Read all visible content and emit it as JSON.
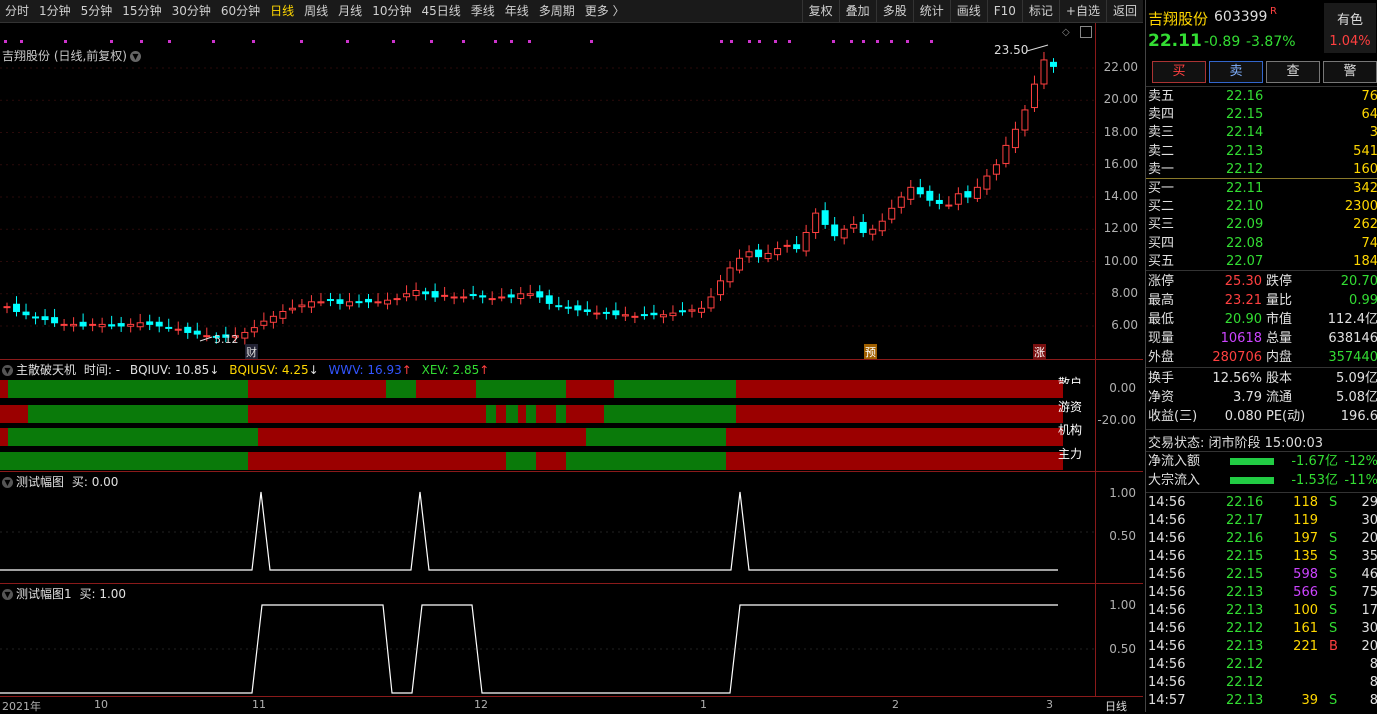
{
  "toolbar": {
    "timeframes": [
      "分时",
      "1分钟",
      "5分钟",
      "15分钟",
      "30分钟",
      "60分钟",
      "日线",
      "周线",
      "月线",
      "10分钟",
      "45日线",
      "季线",
      "年线",
      "多周期",
      "更多 〉"
    ],
    "active_timeframe": "日线",
    "buttons": [
      "复权",
      "叠加",
      "多股",
      "统计",
      "画线",
      "F10",
      "标记",
      "+自选",
      "返回"
    ]
  },
  "chart": {
    "title": "吉翔股份 (日线,前复权)",
    "high_label": "23.50",
    "low_label": "5.12",
    "markers": [
      "财",
      "预",
      "涨"
    ],
    "y_ticks": [
      "22.00",
      "20.00",
      "18.00",
      "16.00",
      "14.00",
      "12.00",
      "10.00",
      "8.00",
      "6.00"
    ],
    "x_labels": [
      "2021年",
      "10",
      "11",
      "12",
      "1",
      "2",
      "3"
    ],
    "period_label": "日线"
  },
  "indicator1": {
    "name": "主散破天机",
    "time_label": "时间: -",
    "bqiuv": "BQIUV: 10.85",
    "bqiusv": "BQIUSV: 4.25",
    "wwv": "WWV: 16.93",
    "xev": "XEV: 2.85",
    "row_labels": [
      "散户",
      "游资",
      "机构",
      "主力"
    ],
    "y_ticks": [
      "0.00",
      "-20.00"
    ]
  },
  "indicator2": {
    "name": "测试幅图",
    "buy": "买: 0.00",
    "y_ticks": [
      "1.00",
      "0.50"
    ]
  },
  "indicator3": {
    "name": "测试幅图1",
    "buy": "买: 1.00",
    "y_ticks": [
      "1.00",
      "0.50"
    ]
  },
  "quote": {
    "name": "吉翔股份",
    "code": "603399",
    "flag": "R",
    "badge": "有色",
    "badge_pct": "1.04%",
    "price": "22.11",
    "change": "-0.89",
    "change_pct": "-3.87%",
    "actions": [
      "买",
      "卖",
      "查",
      "警"
    ],
    "asks": [
      {
        "label": "卖五",
        "price": "22.16",
        "vol": "76"
      },
      {
        "label": "卖四",
        "price": "22.15",
        "vol": "64"
      },
      {
        "label": "卖三",
        "price": "22.14",
        "vol": "3"
      },
      {
        "label": "卖二",
        "price": "22.13",
        "vol": "541"
      },
      {
        "label": "卖一",
        "price": "22.12",
        "vol": "160"
      }
    ],
    "bids": [
      {
        "label": "买一",
        "price": "22.11",
        "vol": "342"
      },
      {
        "label": "买二",
        "price": "22.10",
        "vol": "2300"
      },
      {
        "label": "买三",
        "price": "22.09",
        "vol": "262"
      },
      {
        "label": "买四",
        "price": "22.08",
        "vol": "74"
      },
      {
        "label": "买五",
        "price": "22.07",
        "vol": "184"
      }
    ],
    "stats": [
      {
        "l1": "涨停",
        "v1": "25.30",
        "l2": "跌停",
        "v2": "20.70"
      },
      {
        "l1": "最高",
        "v1": "23.21",
        "l2": "量比",
        "v2": "0.99"
      },
      {
        "l1": "最低",
        "v1": "20.90",
        "l2": "市值",
        "v2": "112.4亿"
      },
      {
        "l1": "现量",
        "v1": "10618",
        "l2": "总量",
        "v2": "638146"
      },
      {
        "l1": "外盘",
        "v1": "280706",
        "l2": "内盘",
        "v2": "357440"
      }
    ],
    "stats2": [
      {
        "l1": "换手",
        "v1": "12.56%",
        "l2": "股本",
        "v2": "5.09亿"
      },
      {
        "l1": "净资",
        "v1": "3.79",
        "l2": "流通",
        "v2": "5.08亿"
      },
      {
        "l1": "收益(三)",
        "v1": "0.080",
        "l2": "PE(动)",
        "v2": "196.6"
      }
    ],
    "trade_status": "交易状态: 闭市阶段 15:00:03",
    "flows": [
      {
        "label": "净流入额",
        "value": "-1.67亿",
        "pct": "-12%"
      },
      {
        "label": "大宗流入",
        "value": "-1.53亿",
        "pct": "-11%"
      }
    ],
    "ticks": [
      {
        "t": "14:56",
        "p": "22.16",
        "v": "118",
        "s": "S",
        "n": "29"
      },
      {
        "t": "14:56",
        "p": "22.17",
        "v": "119",
        "s": "",
        "n": "30"
      },
      {
        "t": "14:56",
        "p": "22.16",
        "v": "197",
        "s": "S",
        "n": "20"
      },
      {
        "t": "14:56",
        "p": "22.15",
        "v": "135",
        "s": "S",
        "n": "35"
      },
      {
        "t": "14:56",
        "p": "22.15",
        "v": "598",
        "s": "S",
        "n": "46"
      },
      {
        "t": "14:56",
        "p": "22.13",
        "v": "566",
        "s": "S",
        "n": "75"
      },
      {
        "t": "14:56",
        "p": "22.13",
        "v": "100",
        "s": "S",
        "n": "17"
      },
      {
        "t": "14:56",
        "p": "22.12",
        "v": "161",
        "s": "S",
        "n": "30"
      },
      {
        "t": "14:56",
        "p": "22.13",
        "v": "221",
        "s": "B",
        "n": "20"
      },
      {
        "t": "14:56",
        "p": "22.12",
        "v": "",
        "s": "",
        "n": "8"
      },
      {
        "t": "14:56",
        "p": "22.12",
        "v": "",
        "s": "",
        "n": "8"
      },
      {
        "t": "14:57",
        "p": "22.13",
        "v": "39",
        "s": "S",
        "n": "8"
      }
    ]
  },
  "colors": {
    "up": "#ff4040",
    "down": "#00ffff",
    "bar_red": "#9b0000",
    "bar_green": "#0a7a0a",
    "accent": "#ffd700"
  }
}
